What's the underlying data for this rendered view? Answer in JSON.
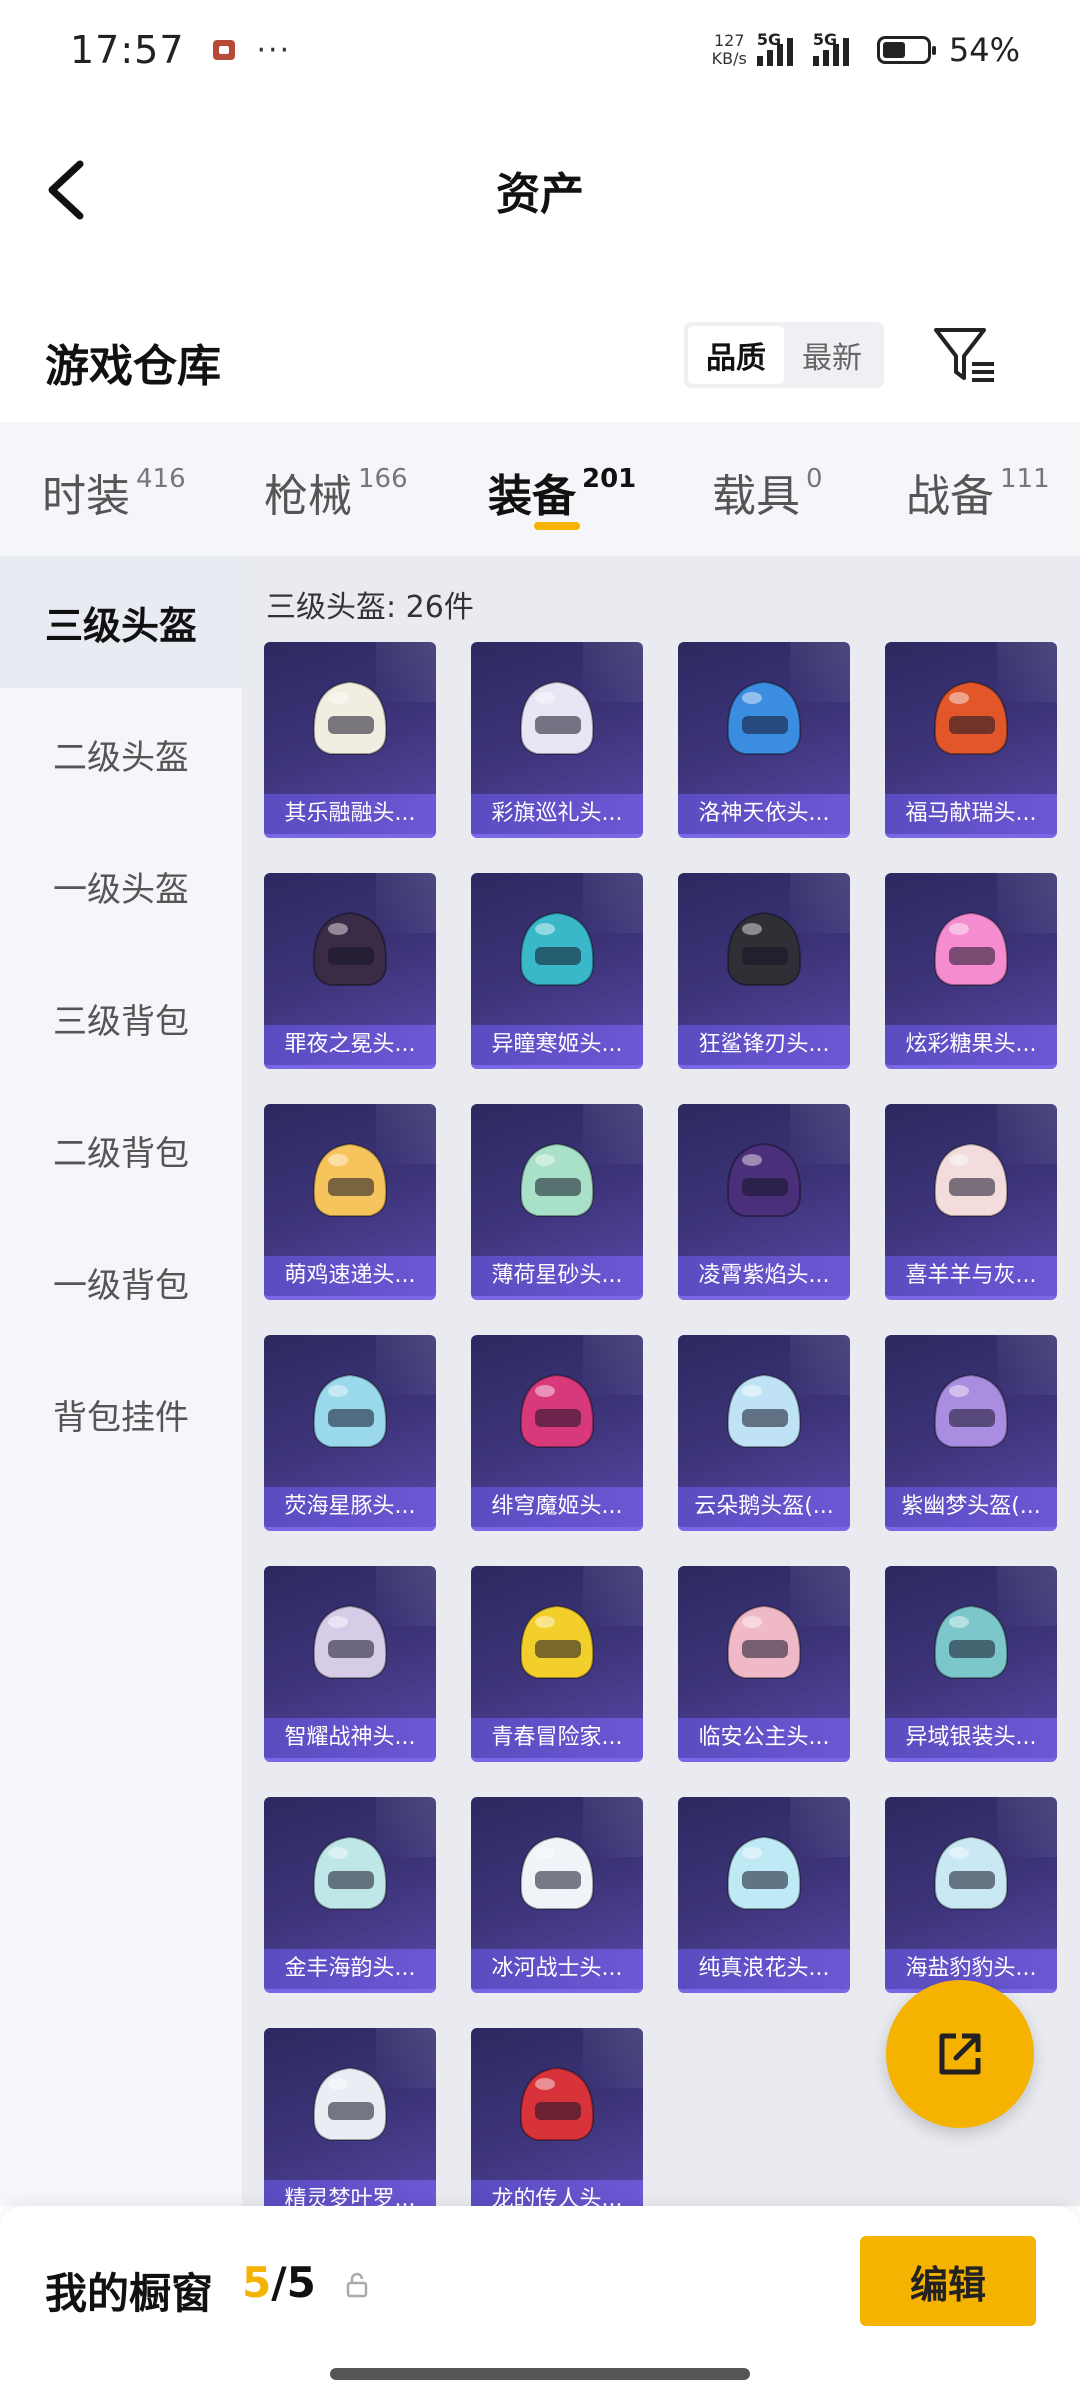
{
  "status_bar": {
    "time": "17:57",
    "more": "···",
    "net_speed_value": "127",
    "net_speed_unit": "KB/s",
    "signal1_label": "5G",
    "signal2_label": "5G",
    "battery": "54%"
  },
  "header": {
    "title": "资产"
  },
  "warehouse": {
    "title": "游戏仓库",
    "sort_options": [
      "品质",
      "最新"
    ],
    "sort_active": "品质"
  },
  "categories": [
    {
      "name": "时装",
      "count": "416"
    },
    {
      "name": "枪械",
      "count": "166"
    },
    {
      "name": "装备",
      "count": "201",
      "active": true
    },
    {
      "name": "载具",
      "count": "0"
    },
    {
      "name": "战备",
      "count": "111"
    }
  ],
  "sidebar": {
    "items": [
      "三级头盔",
      "二级头盔",
      "一级头盔",
      "三级背包",
      "二级背包",
      "一级背包",
      "背包挂件"
    ],
    "active": "三级头盔"
  },
  "content": {
    "section_title": "三级头盔: 26件",
    "items": [
      {
        "name": "其乐融融头...",
        "color": "#f2ede1"
      },
      {
        "name": "彩旗巡礼头...",
        "color": "#e8e6f4"
      },
      {
        "name": "洛神天依头...",
        "color": "#3a8de0"
      },
      {
        "name": "福马献瑞头...",
        "color": "#e2572a"
      },
      {
        "name": "罪夜之冕头...",
        "color": "#3a2b46"
      },
      {
        "name": "异瞳寒姬头...",
        "color": "#39b8c9"
      },
      {
        "name": "狂鲨锋刃头...",
        "color": "#2f2f36"
      },
      {
        "name": "炫彩糖果头...",
        "color": "#f58ccf"
      },
      {
        "name": "萌鸡速递头...",
        "color": "#f6c45c"
      },
      {
        "name": "薄荷星砂头...",
        "color": "#a8e0c8"
      },
      {
        "name": "凌霄紫焰头...",
        "color": "#4a2f7a"
      },
      {
        "name": "喜羊羊与灰...",
        "color": "#f4dcdc"
      },
      {
        "name": "荧海星豚头...",
        "color": "#9ad8ec"
      },
      {
        "name": "绯穹魔姬头...",
        "color": "#d8397a"
      },
      {
        "name": "云朵鹅头盔(...",
        "color": "#bfe3f4"
      },
      {
        "name": "紫幽梦头盔(...",
        "color": "#a98de0"
      },
      {
        "name": "智耀战神头...",
        "color": "#d7cce8"
      },
      {
        "name": "青春冒险家...",
        "color": "#f2cf2a"
      },
      {
        "name": "临安公主头...",
        "color": "#f0b9c7"
      },
      {
        "name": "异域银装头...",
        "color": "#7cc7c9"
      },
      {
        "name": "金丰海韵头...",
        "color": "#bfe7e8"
      },
      {
        "name": "冰河战士头...",
        "color": "#f0f3f8"
      },
      {
        "name": "纯真浪花头...",
        "color": "#bfe9f4"
      },
      {
        "name": "海盐豹豹头...",
        "color": "#c9e8f4"
      },
      {
        "name": "精灵梦叶罗...",
        "color": "#e8eef4"
      },
      {
        "name": "龙的传人头...",
        "color": "#d8323a"
      }
    ]
  },
  "bottom": {
    "label": "我的橱窗",
    "used": "5",
    "separator": "/",
    "total": "5",
    "edit": "编辑"
  },
  "accent": "#f5b200"
}
